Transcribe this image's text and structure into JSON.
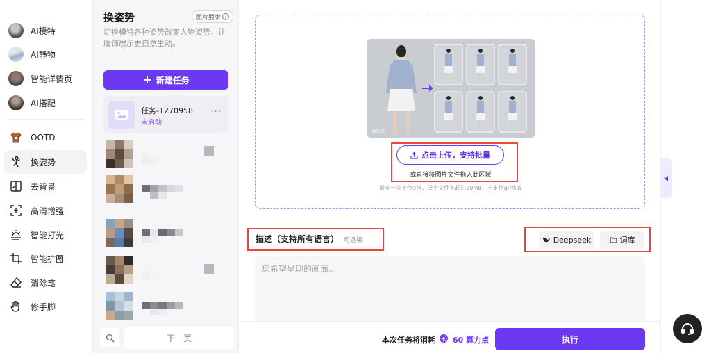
{
  "nav": {
    "items": [
      {
        "label": "AI模特",
        "icon": "avatar"
      },
      {
        "label": "AI静物",
        "icon": "avatar"
      },
      {
        "label": "智能详情页",
        "icon": "avatar"
      },
      {
        "label": "AI搭配",
        "icon": "avatar"
      },
      {
        "label": "OOTD",
        "icon": "shirt-icon"
      },
      {
        "label": "换姿势",
        "icon": "pose-icon",
        "active": true
      },
      {
        "label": "去背景",
        "icon": "split-icon"
      },
      {
        "label": "高清增强",
        "icon": "enhance-icon"
      },
      {
        "label": "智能打光",
        "icon": "light-icon"
      },
      {
        "label": "智能扩图",
        "icon": "crop-icon"
      },
      {
        "label": "消除笔",
        "icon": "eraser-icon"
      },
      {
        "label": "修手脚",
        "icon": "hand-icon"
      }
    ]
  },
  "panel": {
    "title": "换姿势",
    "requirements_label": "图片要求",
    "description": "切换模特各种姿势改变人物姿势，让服饰展示更自然生动。",
    "new_task_label": "新建任务",
    "task": {
      "name": "任务-1270958",
      "status": "未启动"
    },
    "next_page_label": "下一页"
  },
  "main": {
    "after_label": "After",
    "upload_button_label": "点击上传，支持批量",
    "drag_text": "或直接将图片文件拖入此区域",
    "limit_text": "最多一次上传9张，单个文件不超过20MB，不支持gif格式",
    "desc_title": "描述（支持所有语言）",
    "desc_optional": "可选填",
    "deepseek_label": "Deepseek",
    "library_label": "词库",
    "textarea_placeholder": "您希望呈现的画面...",
    "cost_label": "本次任务将消耗",
    "cost_value": "60 算力点",
    "run_label": "执行"
  },
  "colors": {
    "accent": "#6b39f2",
    "highlight": "#e2483d"
  }
}
